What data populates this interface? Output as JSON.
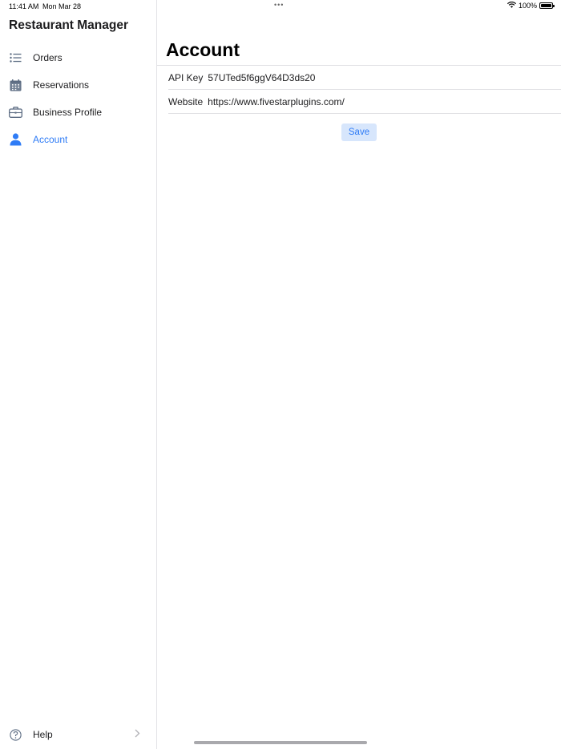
{
  "status_bar": {
    "time": "11:41 AM",
    "date": "Mon Mar 28",
    "battery": "100%"
  },
  "sidebar": {
    "title": "Restaurant Manager",
    "items": [
      {
        "label": "Orders",
        "icon": "list-icon"
      },
      {
        "label": "Reservations",
        "icon": "calendar-icon"
      },
      {
        "label": "Business Profile",
        "icon": "briefcase-icon"
      },
      {
        "label": "Account",
        "icon": "person-icon",
        "active": true
      }
    ],
    "help": {
      "label": "Help",
      "icon": "question-circle-icon"
    }
  },
  "main": {
    "title": "Account",
    "fields": {
      "api_key": {
        "label": "API Key",
        "value": "57UTed5f6ggV64D3ds20"
      },
      "website": {
        "label": "Website",
        "value": "https://www.fivestarplugins.com/"
      }
    },
    "save_label": "Save"
  },
  "colors": {
    "accent": "#2f7cf6",
    "button_bg": "#d7e6fc",
    "icon_gray": "#5b6b82"
  }
}
